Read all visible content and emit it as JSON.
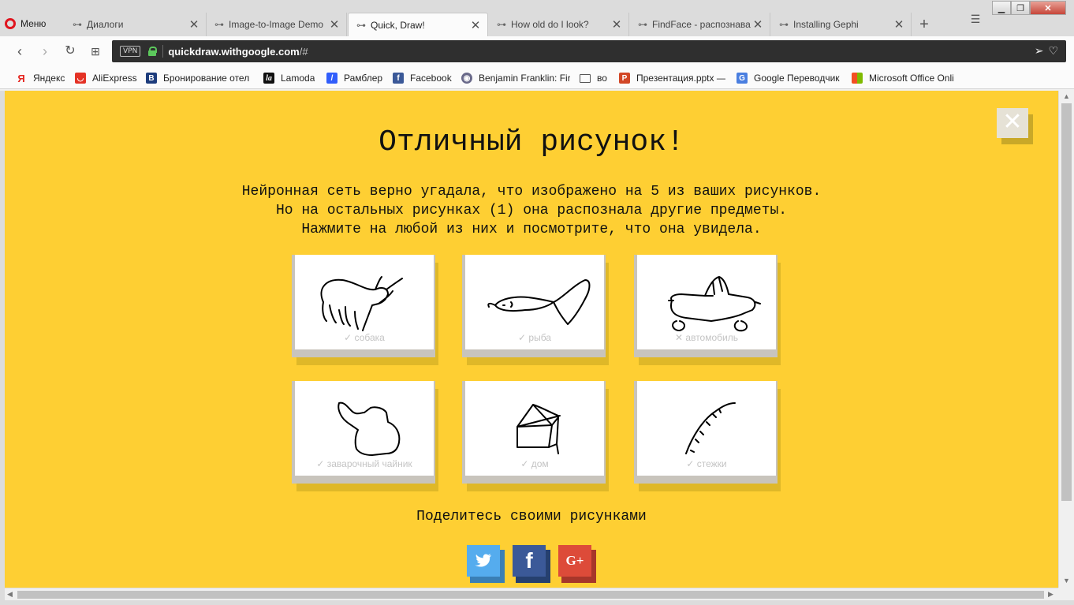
{
  "browser": {
    "menu_label": "Меню",
    "tabs": [
      {
        "title": "Диалоги",
        "icon": "incognito-icon",
        "active": false
      },
      {
        "title": "Image-to-Image Demo",
        "icon": "incognito-icon",
        "active": false
      },
      {
        "title": "Quick, Draw!",
        "icon": "incognito-icon",
        "active": true
      },
      {
        "title": "How old do I look?",
        "icon": "incognito-icon",
        "active": false
      },
      {
        "title": "FindFace - распознава",
        "icon": "incognito-icon",
        "active": false
      },
      {
        "title": "Installing Gephi",
        "icon": "incognito-icon",
        "active": false
      }
    ],
    "vpn_label": "VPN",
    "url": {
      "host": "quickdraw.withgoogle.com",
      "rest": "/#"
    },
    "bookmarks": [
      {
        "label": "Яндекс",
        "icon": "yandex-icon",
        "color": "#e52620"
      },
      {
        "label": "AliExpress",
        "icon": "aliexpress-icon",
        "color": "#e43225"
      },
      {
        "label": "Бронирование отел",
        "icon": "booking-icon",
        "color": "#1d3c7c"
      },
      {
        "label": "Lamoda",
        "icon": "lamoda-icon",
        "color": "#111111"
      },
      {
        "label": "Рамблер",
        "icon": "rambler-icon",
        "color": "#315efb"
      },
      {
        "label": "Facebook",
        "icon": "facebook-icon",
        "color": "#3b5998"
      },
      {
        "label": "Benjamin Franklin: Fir",
        "icon": "seal-icon",
        "color": "#6a6a8a"
      },
      {
        "label": "во",
        "icon": "folder-icon",
        "color": "#ffffff"
      },
      {
        "label": "Презентация.pptx —",
        "icon": "powerpoint-icon",
        "color": "#d24726"
      },
      {
        "label": "Google Переводчик",
        "icon": "translate-icon",
        "color": "#4a7fe0"
      },
      {
        "label": "Microsoft Office Onli",
        "icon": "office-icon",
        "color": "#f25022"
      }
    ]
  },
  "page": {
    "title": "Отличный рисунок!",
    "description": [
      "Нейронная сеть верно угадала, что изображено на 5 из ваших рисунков.",
      "Но на остальных рисунках (1) она распознала другие предметы.",
      "Нажмите на любой из них и посмотрите, что она увидела."
    ],
    "cards": [
      {
        "label": "✓ собака",
        "icon": "dog-drawing",
        "recognized": true
      },
      {
        "label": "✓ рыба",
        "icon": "fish-drawing",
        "recognized": true
      },
      {
        "label": "✕ автомобиль",
        "icon": "car-drawing",
        "recognized": false
      },
      {
        "label": "✓ заварочный чайник",
        "icon": "teapot-drawing",
        "recognized": true
      },
      {
        "label": "✓ дом",
        "icon": "house-drawing",
        "recognized": true
      },
      {
        "label": "✓ стежки",
        "icon": "stitches-drawing",
        "recognized": true
      }
    ],
    "share_label": "Поделитесь своими рисунками",
    "social": [
      {
        "name": "twitter",
        "glyph": "🐦",
        "color": "#55acee",
        "shadow": "#3a7fb5"
      },
      {
        "name": "facebook",
        "glyph": "f",
        "color": "#3b5998",
        "shadow": "#26406f"
      },
      {
        "name": "google-plus",
        "glyph": "G+",
        "color": "#dd4b39",
        "shadow": "#a7362a"
      }
    ],
    "accent_color": "#fecf33"
  }
}
